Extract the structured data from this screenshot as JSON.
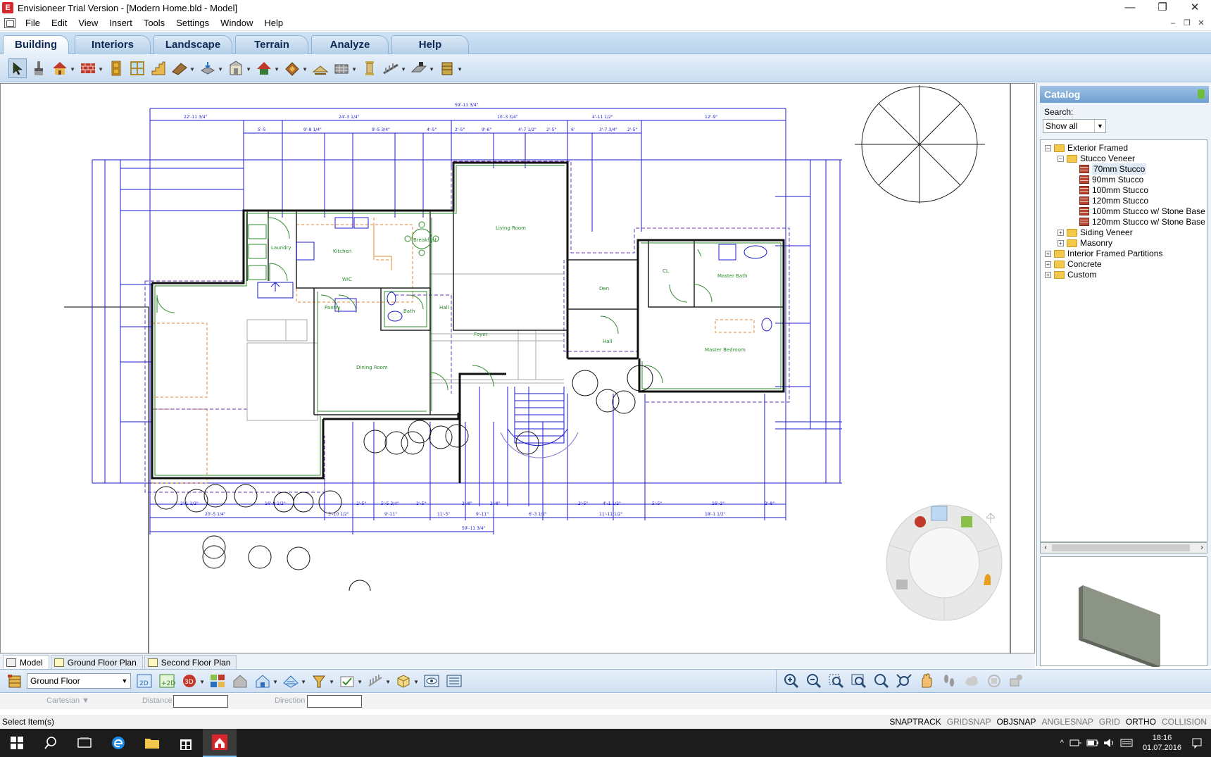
{
  "window": {
    "title": "Envisioneer Trial Version - [Modern Home.bld - Model]",
    "minimize": "—",
    "restore": "❐",
    "close": "✕"
  },
  "menu": {
    "items": [
      "File",
      "Edit",
      "View",
      "Insert",
      "Tools",
      "Settings",
      "Window",
      "Help"
    ],
    "mdi_min": "–",
    "mdi_restore": "❐",
    "mdi_close": "✕"
  },
  "ribbon": {
    "tabs": [
      "Building",
      "Interiors",
      "Landscape",
      "Terrain",
      "Analyze",
      "Help"
    ],
    "active_tab": "Building"
  },
  "catalog": {
    "title": "Catalog",
    "search_label": "Search:",
    "filter_value": "Show all",
    "tree": [
      {
        "label": "Exterior Framed",
        "level": 0,
        "type": "folder",
        "expanded": true
      },
      {
        "label": "Stucco Veneer",
        "level": 1,
        "type": "folder",
        "expanded": true
      },
      {
        "label": "70mm Stucco",
        "level": 2,
        "type": "item",
        "selected": true
      },
      {
        "label": "90mm Stucco",
        "level": 2,
        "type": "item"
      },
      {
        "label": "100mm Stucco",
        "level": 2,
        "type": "item"
      },
      {
        "label": "120mm Stucco",
        "level": 2,
        "type": "item"
      },
      {
        "label": "100mm Stucco w/ Stone Base",
        "level": 2,
        "type": "item"
      },
      {
        "label": "120mm Stucco w/ Stone Base",
        "level": 2,
        "type": "item"
      },
      {
        "label": "Siding Veneer",
        "level": 1,
        "type": "folder",
        "expanded": false
      },
      {
        "label": "Masonry",
        "level": 1,
        "type": "folder",
        "expanded": false
      },
      {
        "label": "Interior Framed Partitions",
        "level": 0,
        "type": "folder",
        "expanded": false
      },
      {
        "label": "Concrete",
        "level": 0,
        "type": "folder",
        "expanded": false
      },
      {
        "label": "Custom",
        "level": 0,
        "type": "folder",
        "expanded": false
      }
    ]
  },
  "floorplan": {
    "rooms": {
      "living": "Living Room",
      "kitchen": "Kitchen",
      "dining": "Dining Room",
      "master_bed": "Master Bedroom",
      "master_bath": "Master Bath",
      "bath": "Bath",
      "den": "Den",
      "pantry": "Pantry",
      "laundry": "Laundry",
      "foyer": "Foyer",
      "hall": "Hall",
      "hall2": "Hall",
      "closet": "CL",
      "breakfast": "Breakfast",
      "wic": "WIC"
    }
  },
  "view_tabs": [
    "Model",
    "Ground Floor Plan",
    "Second Floor Plan"
  ],
  "active_view_tab": "Model",
  "bottom": {
    "floor_value": "Ground Floor"
  },
  "coords": {
    "mode_label": "Cartesian ▼",
    "distance_label": "Distance",
    "direction_label": "Direction"
  },
  "status": {
    "message": "Select Item(s)",
    "modes": [
      {
        "label": "SNAPTRACK",
        "on": true
      },
      {
        "label": "GRIDSNAP",
        "on": false
      },
      {
        "label": "OBJSNAP",
        "on": true
      },
      {
        "label": "ANGLESNAP",
        "on": false
      },
      {
        "label": "GRID",
        "on": false
      },
      {
        "label": "ORTHO",
        "on": true
      },
      {
        "label": "COLLISION",
        "on": false
      }
    ]
  },
  "taskbar": {
    "time": "18:16",
    "date": "01.07.2016"
  },
  "colors": {
    "dimension": "#1b1bd0",
    "wall": "#111111",
    "room_label": "#2a8a2a",
    "accent": "#6f9fd0"
  }
}
